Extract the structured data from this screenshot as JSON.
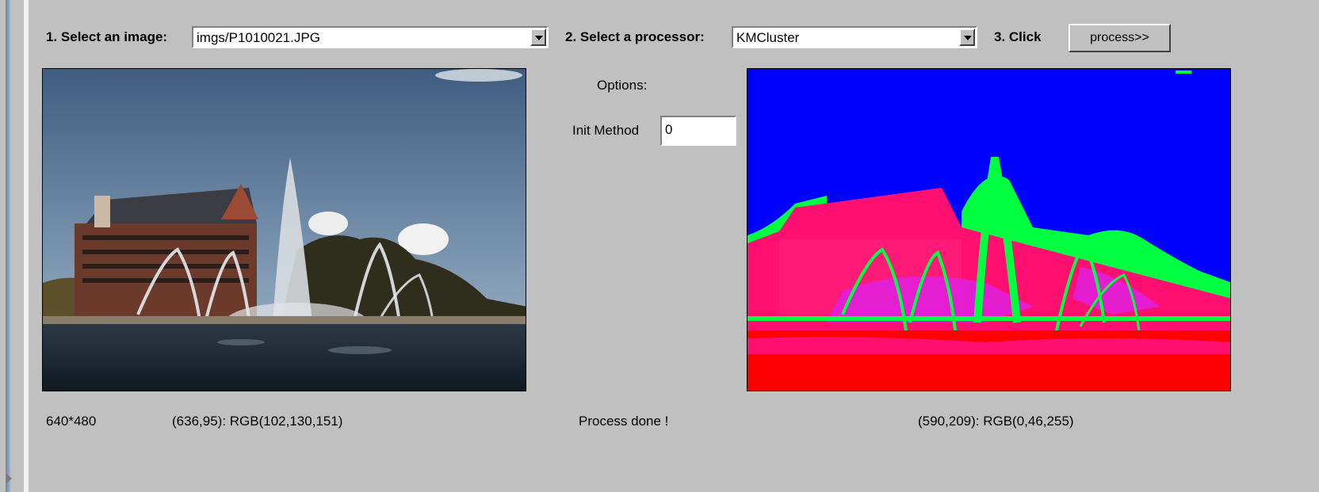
{
  "header": {
    "select_image_label": "1. Select an image:",
    "image_value": "imgs/P1010021.JPG",
    "select_processor_label": "2. Select a processor:",
    "processor_value": "KMCluster",
    "click_label": "3. Click",
    "process_button_label": "process>>"
  },
  "options": {
    "title": "Options:",
    "init_method_label": "Init Method",
    "init_method_value": "0"
  },
  "status": {
    "dimensions": "640*480",
    "source_pixel": "(636,95): RGB(102,130,151)",
    "process_message": "Process done !",
    "result_pixel": "(590,209): RGB(0,46,255)"
  },
  "colors": {
    "window_bg": "#c0c0c0",
    "cluster_blue": "#0000ff",
    "cluster_green": "#00ff40",
    "cluster_pink": "#ff1070",
    "cluster_magenta": "#e020e0",
    "cluster_red": "#ff0000"
  },
  "icons": {
    "dropdown": "chevron-down-icon",
    "scroll": "arrow-right-icon"
  }
}
